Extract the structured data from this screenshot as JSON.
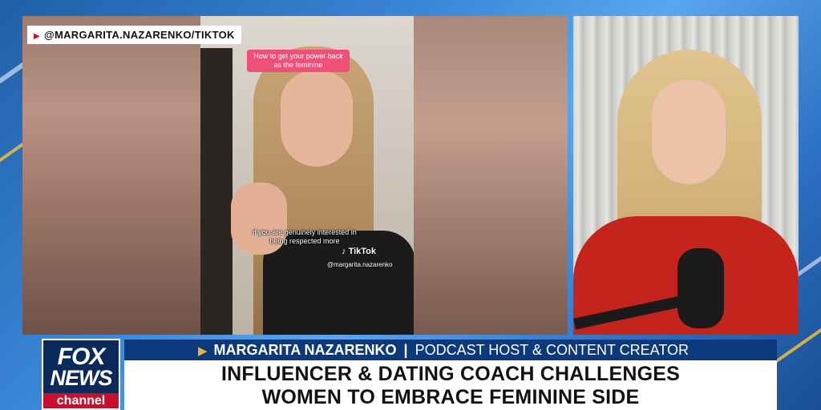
{
  "source_tag": {
    "text": "@MARGARITA.NAZARENKO/TIKTOK"
  },
  "tiktok_video": {
    "caption_top": "How to get your power back as the feminine",
    "caption_bottom": "if you are genuinely interested in being respected more",
    "platform_label": "TikTok",
    "handle": "@margarita.nazarenko"
  },
  "network_logo": {
    "line1": "FOX",
    "line2": "NEWS",
    "line3": "channel"
  },
  "name_bar": {
    "name": "MARGARITA NAZARENKO",
    "separator": "|",
    "title": "PODCAST HOST & CONTENT CREATOR"
  },
  "headline": {
    "line1": "INFLUENCER & DATING COACH CHALLENGES",
    "line2": "WOMEN TO EMBRACE FEMININE SIDE"
  },
  "colors": {
    "brand_navy": "#0a3a7c",
    "accent_red": "#c8102e",
    "tiktok_pink": "#f04f78"
  }
}
